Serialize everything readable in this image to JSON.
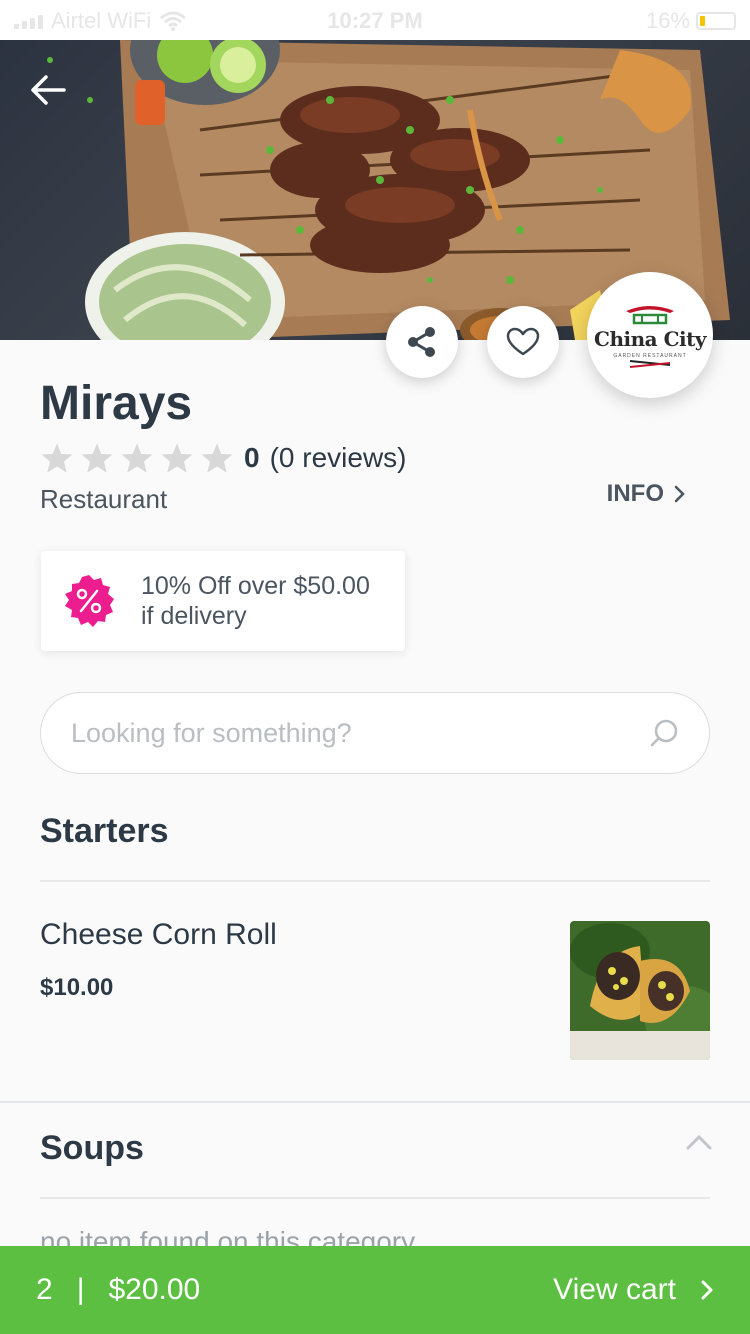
{
  "status_bar": {
    "carrier": "Airtel WiFi",
    "time": "10:27 PM",
    "battery": "16%",
    "battery_level": 0.16
  },
  "restaurant": {
    "name": "Mirays",
    "rating_value": "0",
    "reviews_text": "(0 reviews)",
    "stars_filled": 0,
    "stars_total": 5,
    "type": "Restaurant",
    "info_label": "INFO",
    "logo_text": "China City",
    "logo_subtext": "GARDEN RESTAURANT"
  },
  "promo": {
    "line1": "10% Off over $50.00",
    "line2": "if delivery",
    "icon": "percent-badge-icon",
    "color": "#ec1d8e"
  },
  "search": {
    "placeholder": "Looking for something?"
  },
  "categories": [
    {
      "title": "Starters",
      "items": [
        {
          "name": "Cheese Corn Roll",
          "price": "$10.00"
        }
      ]
    },
    {
      "title": "Soups",
      "expanded": true,
      "empty_text": "no item found on this category"
    }
  ],
  "cart": {
    "count": "2",
    "separator": "|",
    "total": "$20.00",
    "cta": "View cart",
    "color": "#5cbf41"
  }
}
